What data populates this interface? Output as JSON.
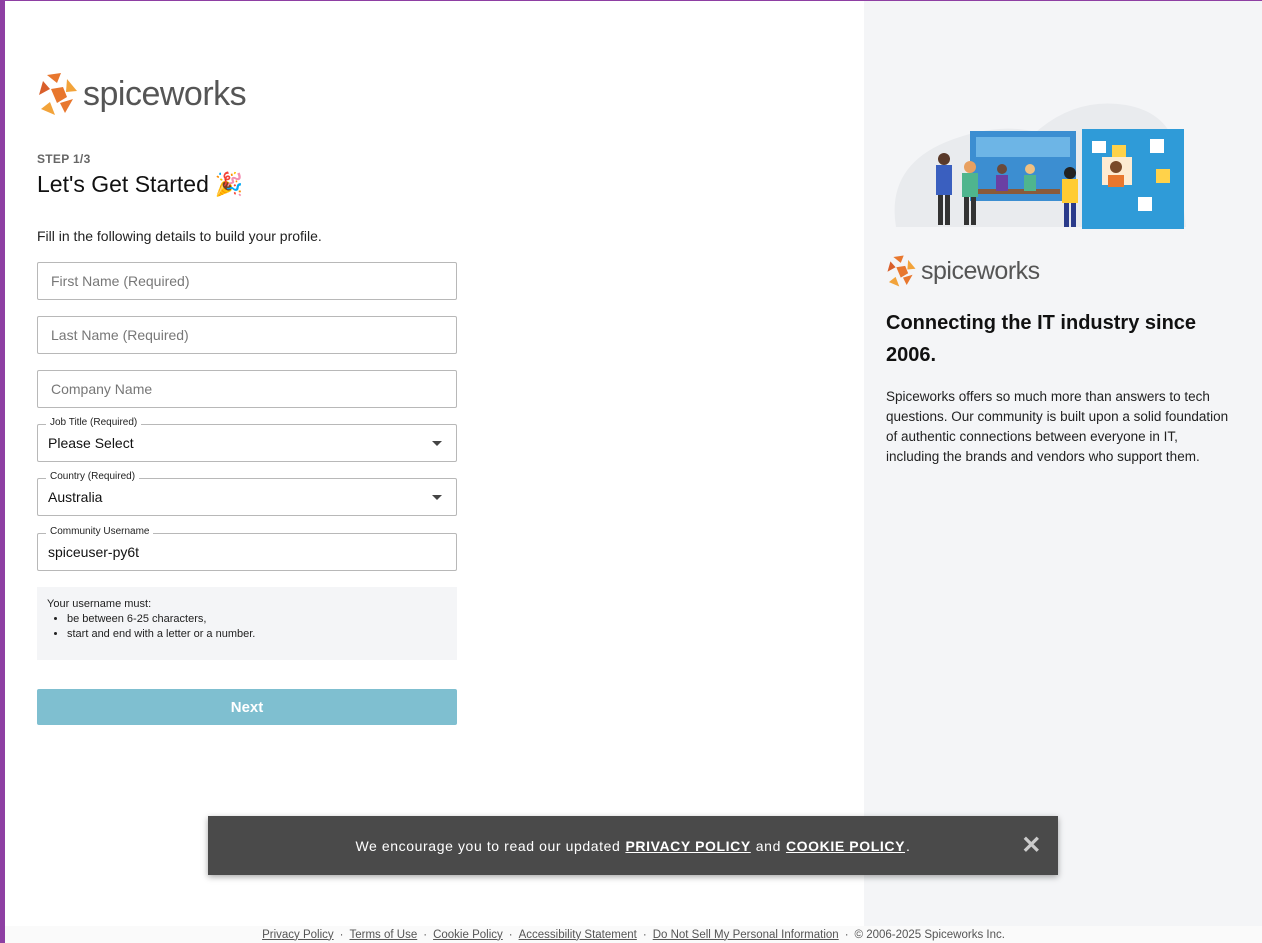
{
  "brand": {
    "name": "spiceworks",
    "accent": "#e8772e"
  },
  "form": {
    "step": "STEP 1/3",
    "title": "Let's Get Started",
    "title_emoji": "🎉",
    "intro": "Fill in the following details to build your profile.",
    "first_name": {
      "placeholder": "First Name (Required)"
    },
    "last_name": {
      "placeholder": "Last Name (Required)"
    },
    "company": {
      "placeholder": "Company Name"
    },
    "job_title": {
      "label": "Job Title (Required)",
      "value": "Please Select"
    },
    "country": {
      "label": "Country (Required)",
      "value": "Australia"
    },
    "username": {
      "label": "Community Username",
      "value": "spiceuser-py6t"
    },
    "rules": {
      "heading": "Your username must:",
      "items": [
        "be between 6-25 characters,",
        "start and end with a letter or a number."
      ]
    },
    "next_label": "Next"
  },
  "side": {
    "title": "Connecting the IT industry since 2006.",
    "body": "Spiceworks offers so much more than answers to tech questions. Our community is built upon a solid foundation of authentic connections between everyone in IT, including the brands and vendors who support them."
  },
  "banner": {
    "text_before": "We encourage you to read our updated",
    "privacy_link": "PRIVACY POLICY",
    "and": "and",
    "cookie_link": "COOKIE POLICY",
    "text_after": ".",
    "close": "✕"
  },
  "footer": {
    "links": [
      "Privacy Policy",
      "Terms of Use",
      "Cookie Policy",
      "Accessibility Statement",
      "Do Not Sell My Personal Information"
    ],
    "separator": "·",
    "copyright": "© 2006-2025 Spiceworks Inc."
  }
}
